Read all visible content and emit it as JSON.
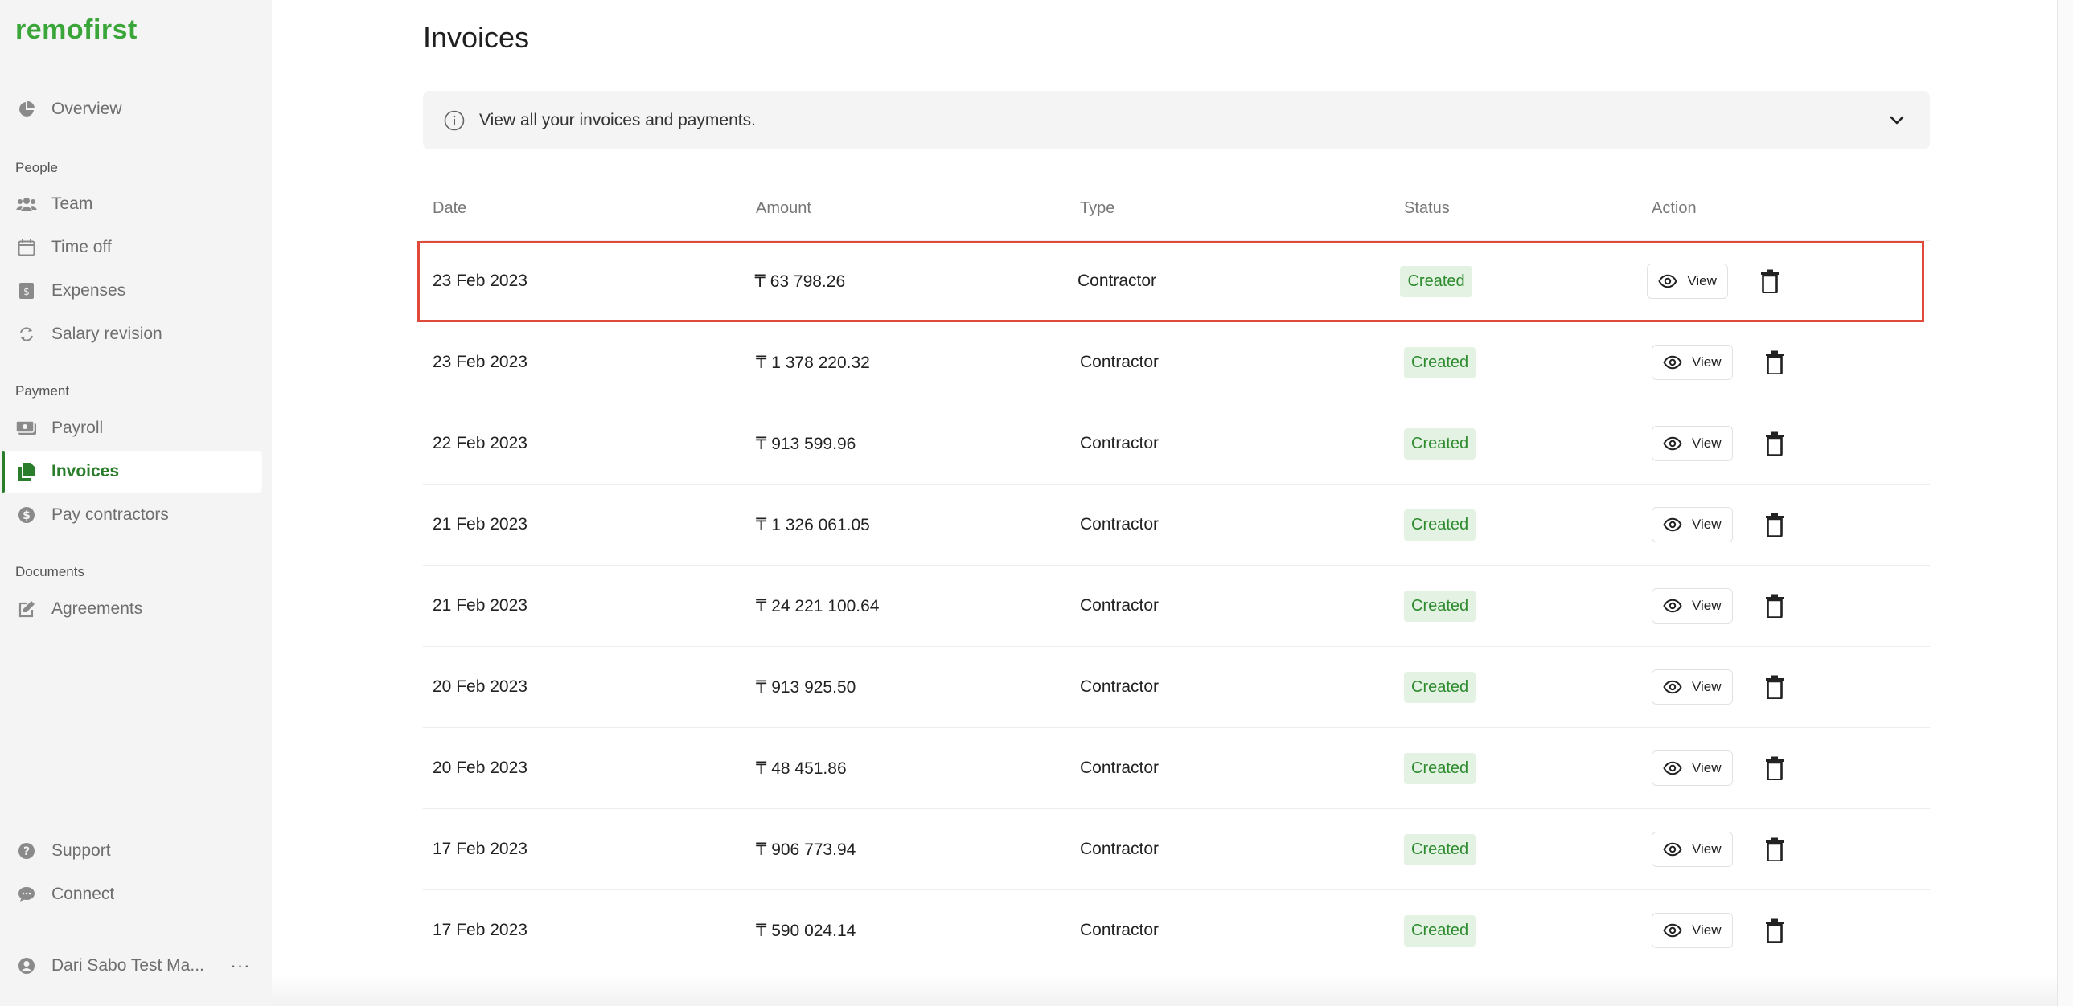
{
  "app": {
    "logo": "remofirst"
  },
  "sidebar": {
    "overview": "Overview",
    "people_label": "People",
    "team": "Team",
    "time_off": "Time off",
    "expenses": "Expenses",
    "salary_revision": "Salary revision",
    "payment_label": "Payment",
    "payroll": "Payroll",
    "invoices": "Invoices",
    "pay_contractors": "Pay contractors",
    "documents_label": "Documents",
    "agreements": "Agreements",
    "support": "Support",
    "connect": "Connect",
    "user_name": "Dari Sabo Test Ma...",
    "more": "···"
  },
  "page": {
    "title": "Invoices",
    "info_text": "View all your invoices and payments."
  },
  "table": {
    "headers": {
      "date": "Date",
      "amount": "Amount",
      "type": "Type",
      "status": "Status",
      "action": "Action"
    },
    "view_label": "View",
    "rows": [
      {
        "date": "23 Feb 2023",
        "amount": "₸ 63 798.26",
        "type": "Contractor",
        "status": "Created"
      },
      {
        "date": "23 Feb 2023",
        "amount": "₸ 1 378 220.32",
        "type": "Contractor",
        "status": "Created"
      },
      {
        "date": "22 Feb 2023",
        "amount": "₸ 913 599.96",
        "type": "Contractor",
        "status": "Created"
      },
      {
        "date": "21 Feb 2023",
        "amount": "₸ 1 326 061.05",
        "type": "Contractor",
        "status": "Created"
      },
      {
        "date": "21 Feb 2023",
        "amount": "₸ 24 221 100.64",
        "type": "Contractor",
        "status": "Created"
      },
      {
        "date": "20 Feb 2023",
        "amount": "₸ 913 925.50",
        "type": "Contractor",
        "status": "Created"
      },
      {
        "date": "20 Feb 2023",
        "amount": "₸ 48 451.86",
        "type": "Contractor",
        "status": "Created"
      },
      {
        "date": "17 Feb 2023",
        "amount": "₸ 906 773.94",
        "type": "Contractor",
        "status": "Created"
      },
      {
        "date": "17 Feb 2023",
        "amount": "₸ 590 024.14",
        "type": "Contractor",
        "status": "Created"
      }
    ]
  },
  "colors": {
    "brand": "#3aa63a",
    "active_nav": "#2a7d2a",
    "status_bg": "#e3f2e3",
    "status_text": "#2e8b2e",
    "highlight": "#e04a3a"
  }
}
